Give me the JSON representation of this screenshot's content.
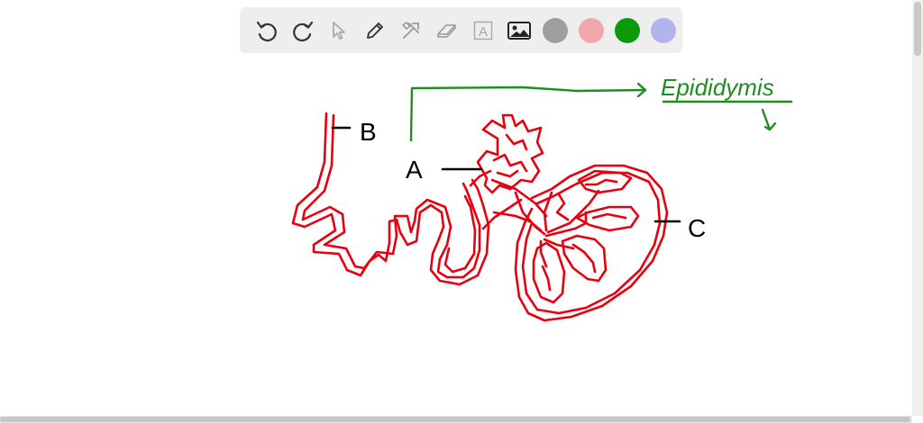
{
  "toolbar": {
    "tools": [
      {
        "name": "undo-icon"
      },
      {
        "name": "redo-icon"
      },
      {
        "name": "pointer-icon"
      },
      {
        "name": "pen-icon"
      },
      {
        "name": "tools-icon"
      },
      {
        "name": "eraser-icon"
      },
      {
        "name": "text-icon",
        "glyph": "A"
      },
      {
        "name": "image-icon"
      }
    ],
    "colors": [
      "#9e9e9e",
      "#f0a8ac",
      "#0a9a0a",
      "#b3b3ee"
    ]
  },
  "drawing": {
    "label_a": "A",
    "label_b": "B",
    "label_c": "C",
    "annotation": "Epididymis",
    "ink_red": "#e8000f",
    "ink_green": "#1d8f1d",
    "ink_black": "#000000"
  }
}
